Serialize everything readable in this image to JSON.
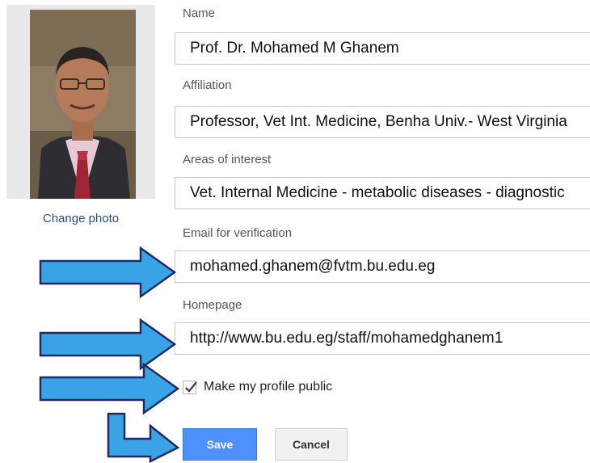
{
  "photo": {
    "change_label": "Change photo"
  },
  "form": {
    "name": {
      "label": "Name",
      "value": "Prof. Dr. Mohamed M Ghanem"
    },
    "affiliation": {
      "label": "Affiliation",
      "value": "Professor, Vet Int. Medicine, Benha Univ.- West Virginia"
    },
    "interests": {
      "label": "Areas of interest",
      "value": "Vet. Internal Medicine - metabolic diseases - diagnostic"
    },
    "email": {
      "label": "Email for verification",
      "value": "mohamed.ghanem@fvtm.bu.edu.eg"
    },
    "homepage": {
      "label": "Homepage",
      "value": "http://www.bu.edu.eg/staff/mohamedghanem1"
    },
    "public": {
      "label": "Make my profile public",
      "checked": true
    }
  },
  "buttons": {
    "save": "Save",
    "cancel": "Cancel"
  },
  "colors": {
    "arrow_fill": "#39a3e6",
    "arrow_stroke": "#1f2a6b",
    "save_bg": "#4d90fe"
  }
}
